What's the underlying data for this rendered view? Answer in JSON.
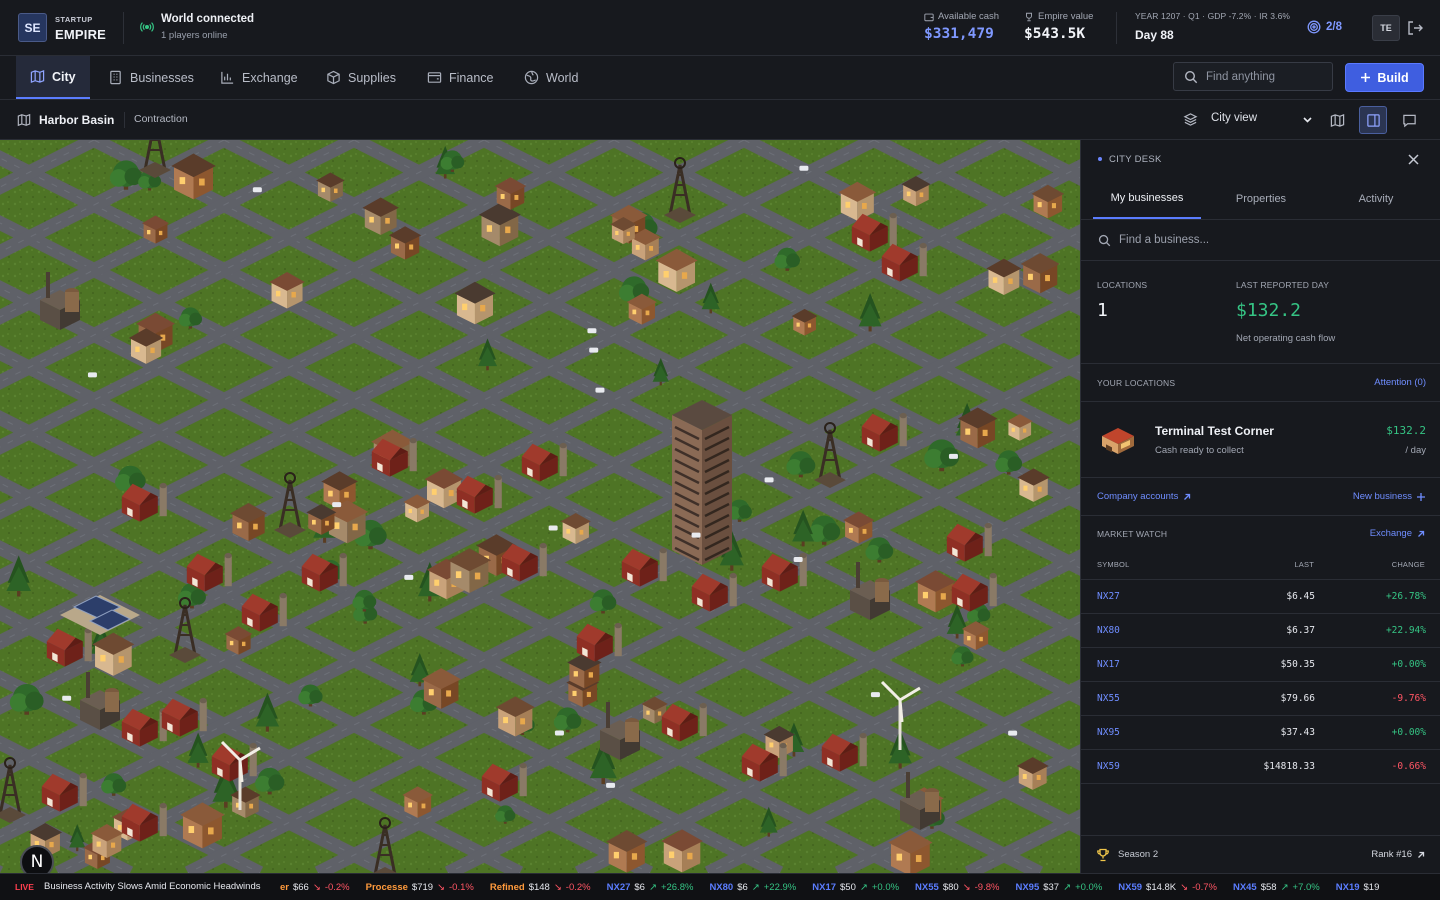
{
  "brand": {
    "logo": "SE",
    "small": "STARTUP",
    "big": "EMPIRE"
  },
  "connection": {
    "title": "World connected",
    "sub": "1 players online",
    "icon": "broadcast-icon"
  },
  "stats": {
    "cash_label": "Available cash",
    "cash_value": "$331,479",
    "empire_label": "Empire value",
    "empire_value": "$543.5K",
    "econ_line": "YEAR 1207 · Q1 · GDP -7.2% · IR 3.6%",
    "day": "Day 88",
    "players": "2/8",
    "avatar": "TE"
  },
  "nav": {
    "tabs": [
      {
        "label": "City",
        "icon": "map-icon"
      },
      {
        "label": "Businesses",
        "icon": "building-icon"
      },
      {
        "label": "Exchange",
        "icon": "bar-chart-icon"
      },
      {
        "label": "Supplies",
        "icon": "box-icon"
      },
      {
        "label": "Finance",
        "icon": "wallet-icon"
      },
      {
        "label": "World",
        "icon": "globe-icon"
      }
    ],
    "search_placeholder": "Find anything",
    "build_label": "Build"
  },
  "subbar": {
    "district": "Harbor Basin",
    "status": "Contraction",
    "view_select": "City view"
  },
  "panel": {
    "title": "CITY DESK",
    "tabs": [
      "My businesses",
      "Properties",
      "Activity"
    ],
    "search_placeholder": "Find a business...",
    "locations_label": "LOCATIONS",
    "locations_value": "1",
    "last_day_label": "LAST REPORTED DAY",
    "last_day_value": "$132.2",
    "last_day_sub": "Net operating cash flow",
    "your_locations": "YOUR LOCATIONS",
    "attention": "Attention (0)",
    "location": {
      "name": "Terminal Test Corner",
      "sub": "Cash ready to collect",
      "amount": "$132.2",
      "per": "/ day"
    },
    "company_accounts": "Company accounts",
    "new_business": "New business",
    "market_watch": "MARKET WATCH",
    "exchange_link": "Exchange",
    "cols": {
      "symbol": "SYMBOL",
      "last": "LAST",
      "change": "CHANGE"
    },
    "market": [
      {
        "sym": "NX27",
        "last": "$6.45",
        "chg": "+26.78%",
        "dir": "up"
      },
      {
        "sym": "NX80",
        "last": "$6.37",
        "chg": "+22.94%",
        "dir": "up"
      },
      {
        "sym": "NX17",
        "last": "$50.35",
        "chg": "+0.00%",
        "dir": "up"
      },
      {
        "sym": "NX55",
        "last": "$79.66",
        "chg": "-9.76%",
        "dir": "down"
      },
      {
        "sym": "NX95",
        "last": "$37.43",
        "chg": "+0.00%",
        "dir": "up"
      },
      {
        "sym": "NX59",
        "last": "$14818.33",
        "chg": "-0.66%",
        "dir": "down"
      }
    ],
    "season": "Season 2",
    "rank": "Rank #16"
  },
  "ticker": {
    "live": "LIVE",
    "headline": "Business Activity Slows Amid Economic Headwinds",
    "items": [
      {
        "sym": "er",
        "price": "$66",
        "chg": "-0.2%",
        "dir": "down",
        "kind": "commodity"
      },
      {
        "sym": "Processe",
        "price": "$719",
        "chg": "-0.1%",
        "dir": "down",
        "kind": "commodity"
      },
      {
        "sym": "Refined",
        "price": "$148",
        "chg": "-0.2%",
        "dir": "down",
        "kind": "commodity"
      },
      {
        "sym": "NX27",
        "price": "$6",
        "chg": "+26.8%",
        "dir": "up",
        "kind": "stock"
      },
      {
        "sym": "NX80",
        "price": "$6",
        "chg": "+22.9%",
        "dir": "up",
        "kind": "stock"
      },
      {
        "sym": "NX17",
        "price": "$50",
        "chg": "+0.0%",
        "dir": "up",
        "kind": "stock"
      },
      {
        "sym": "NX55",
        "price": "$80",
        "chg": "-9.8%",
        "dir": "down",
        "kind": "stock"
      },
      {
        "sym": "NX95",
        "price": "$37",
        "chg": "+0.0%",
        "dir": "up",
        "kind": "stock"
      },
      {
        "sym": "NX59",
        "price": "$14.8K",
        "chg": "-0.7%",
        "dir": "down",
        "kind": "stock"
      },
      {
        "sym": "NX45",
        "price": "$58",
        "chg": "+7.0%",
        "dir": "up",
        "kind": "stock"
      },
      {
        "sym": "NX19",
        "price": "$19",
        "chg": "",
        "dir": "up",
        "kind": "stock"
      }
    ]
  },
  "map_badge": "N",
  "colors": {
    "accent": "#5b7dff",
    "up": "#35c484",
    "down": "#ff5564",
    "commodity": "#ff9a3c"
  }
}
